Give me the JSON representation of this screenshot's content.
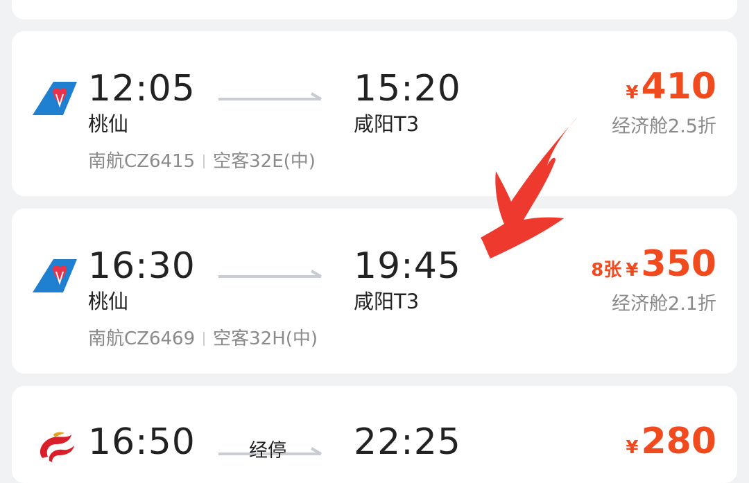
{
  "flights": [
    {
      "airline_logo": "china-southern-logo",
      "dep_time": "12:05",
      "dep_airport": "桃仙",
      "arr_time": "15:20",
      "arr_airport": "咸阳T3",
      "flight": "南航CZ6415",
      "aircraft": "空客32E(中)",
      "currency": "¥",
      "price": "410",
      "cabin": "经济舱2.5折"
    },
    {
      "airline_logo": "china-southern-logo",
      "dep_time": "16:30",
      "dep_airport": "桃仙",
      "arr_time": "19:45",
      "arr_airport": "咸阳T3",
      "flight": "南航CZ6469",
      "aircraft": "空客32H(中)",
      "tickets_left": "8张",
      "currency": "¥",
      "price": "350",
      "cabin": "经济舱2.1折"
    },
    {
      "airline_logo": "hainan-airlines-logo",
      "dep_time": "16:50",
      "stopover": "经停",
      "arr_time": "22:25",
      "currency": "¥",
      "price": "280"
    }
  ],
  "colors": {
    "price": "#f14a1e",
    "annotation_arrow": "#ee3a2e",
    "china_southern_blue": "#1f7fd0",
    "hainan_red": "#d91f2a"
  }
}
